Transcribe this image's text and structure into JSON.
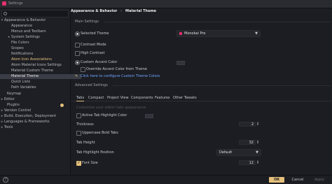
{
  "window": {
    "title": "Settings"
  },
  "sidebar": {
    "items": [
      {
        "label": "Appearance & Behavior",
        "arrow": "▾"
      },
      {
        "label": "Appearance"
      },
      {
        "label": "Menus and Toolbars"
      },
      {
        "label": "System Settings",
        "arrow": "▸"
      },
      {
        "label": "File Colors"
      },
      {
        "label": "Scopes"
      },
      {
        "label": "Notifications"
      },
      {
        "label": "Atom Icon Associations"
      },
      {
        "label": "Atom Material Icons Settings"
      },
      {
        "label": "Material Custom Theme"
      },
      {
        "label": "Material Theme"
      },
      {
        "label": "Quick Lists"
      },
      {
        "label": "Path Variables"
      },
      {
        "label": "Keymap"
      },
      {
        "label": "Editor",
        "arrow": "▸"
      },
      {
        "label": "Plugins"
      },
      {
        "label": "Version Control",
        "arrow": "▸"
      },
      {
        "label": "Build, Execution, Deployment",
        "arrow": "▸"
      },
      {
        "label": "Languages & Frameworks",
        "arrow": "▸"
      },
      {
        "label": "Tools",
        "arrow": "▸"
      }
    ]
  },
  "main": {
    "breadcrumb_parent": "Appearance & Behavior",
    "breadcrumb_sep": "›",
    "breadcrumb_current": "Material Theme",
    "main_settings_title": "Main Settings",
    "selected_theme_label": "Selected Theme",
    "selected_theme_value": "Monokai Pro",
    "contrast_mode_label": "Contrast Mode",
    "high_contrast_label": "High Contrast",
    "custom_accent_label": "Custom Accent Color",
    "override_accent_label": "Override Accent Color from Theme",
    "configure_link": "Click here to configure Custom Theme Colors",
    "advanced_title": "Advanced Settings",
    "tabs": [
      "Tabs",
      "Compact",
      "Project View",
      "Components",
      "Features",
      "Other Tweaks"
    ],
    "tabs_hint": "Customize your editor tabs appearance",
    "active_tab_highlight_label": "Active Tab Highlight Color",
    "thickness_label": "Thickness",
    "thickness_value": "2",
    "uppercase_bold_label": "Uppercase Bold Tabs",
    "tab_height_label": "Tab Height",
    "tab_height_value": "32",
    "tab_highlight_position_label": "Tab Highlight Position",
    "tab_highlight_position_value": "Default",
    "font_size_label": "Font Size",
    "font_size_value": "12"
  },
  "footer": {
    "help": "?",
    "ok_label": "OK",
    "cancel_label": "Cancel",
    "apply_label": "Apply"
  },
  "colors": {
    "accent": "#e5c07b",
    "link": "#6fa4ff",
    "selection": "#3a3d46",
    "theme_icon": "#e6306e"
  }
}
